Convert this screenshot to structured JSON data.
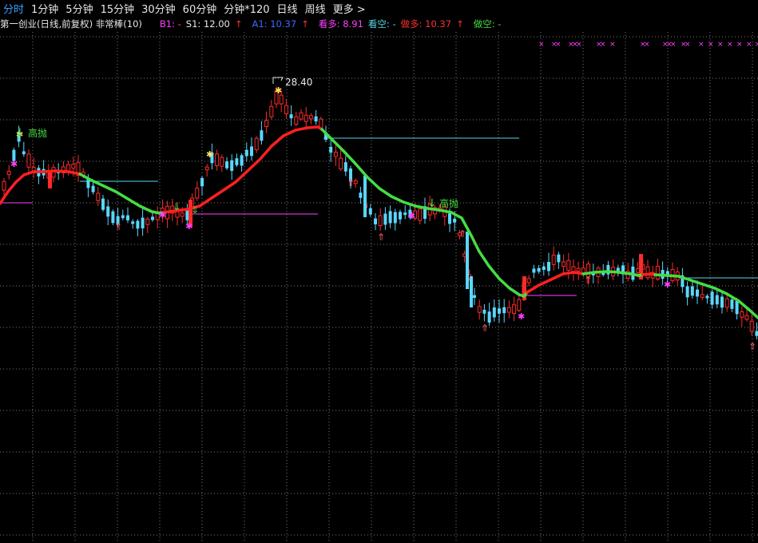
{
  "toolbar": {
    "tabs": [
      "分时",
      "1分钟",
      "5分钟",
      "15分钟",
      "30分钟",
      "60分钟",
      "分钟*120",
      "日线",
      "周线",
      "更多"
    ],
    "more_arrow": ">"
  },
  "infobar": {
    "title": "第一创业(日线,前复权) 非常棒(10)",
    "b1": "B1: -",
    "s1": "S1: 12.00",
    "s1_arrow": "↑",
    "a1": "A1: 10.37",
    "a1_arrow": "↑",
    "kanduo": "看多: 8.91",
    "kankong": "看空: -",
    "zuoduo": "做多: 10.37",
    "zuoduo_arrow": "↑",
    "zuokong": "做空: -"
  },
  "annotations": {
    "peak_price": "28.40",
    "sell_label_1": "高抛",
    "sell_label_2": "高抛",
    "x_markers": [
      "×",
      "××",
      "×××",
      "××",
      "×",
      "××",
      "×××",
      "××",
      "×",
      "×",
      "×",
      "×",
      "×",
      "×",
      "×"
    ]
  },
  "colors": {
    "up": "#ff2a2a",
    "down": "#5ad7ff",
    "line_up": "#ff2020",
    "line_down": "#44dd44",
    "grid": "#7a7a7a",
    "magenta": "#ff40ff",
    "cyan_line": "#54d8e8"
  },
  "chart_data": {
    "type": "candlestick",
    "y_peak_label": 28.4,
    "grid": true
  }
}
